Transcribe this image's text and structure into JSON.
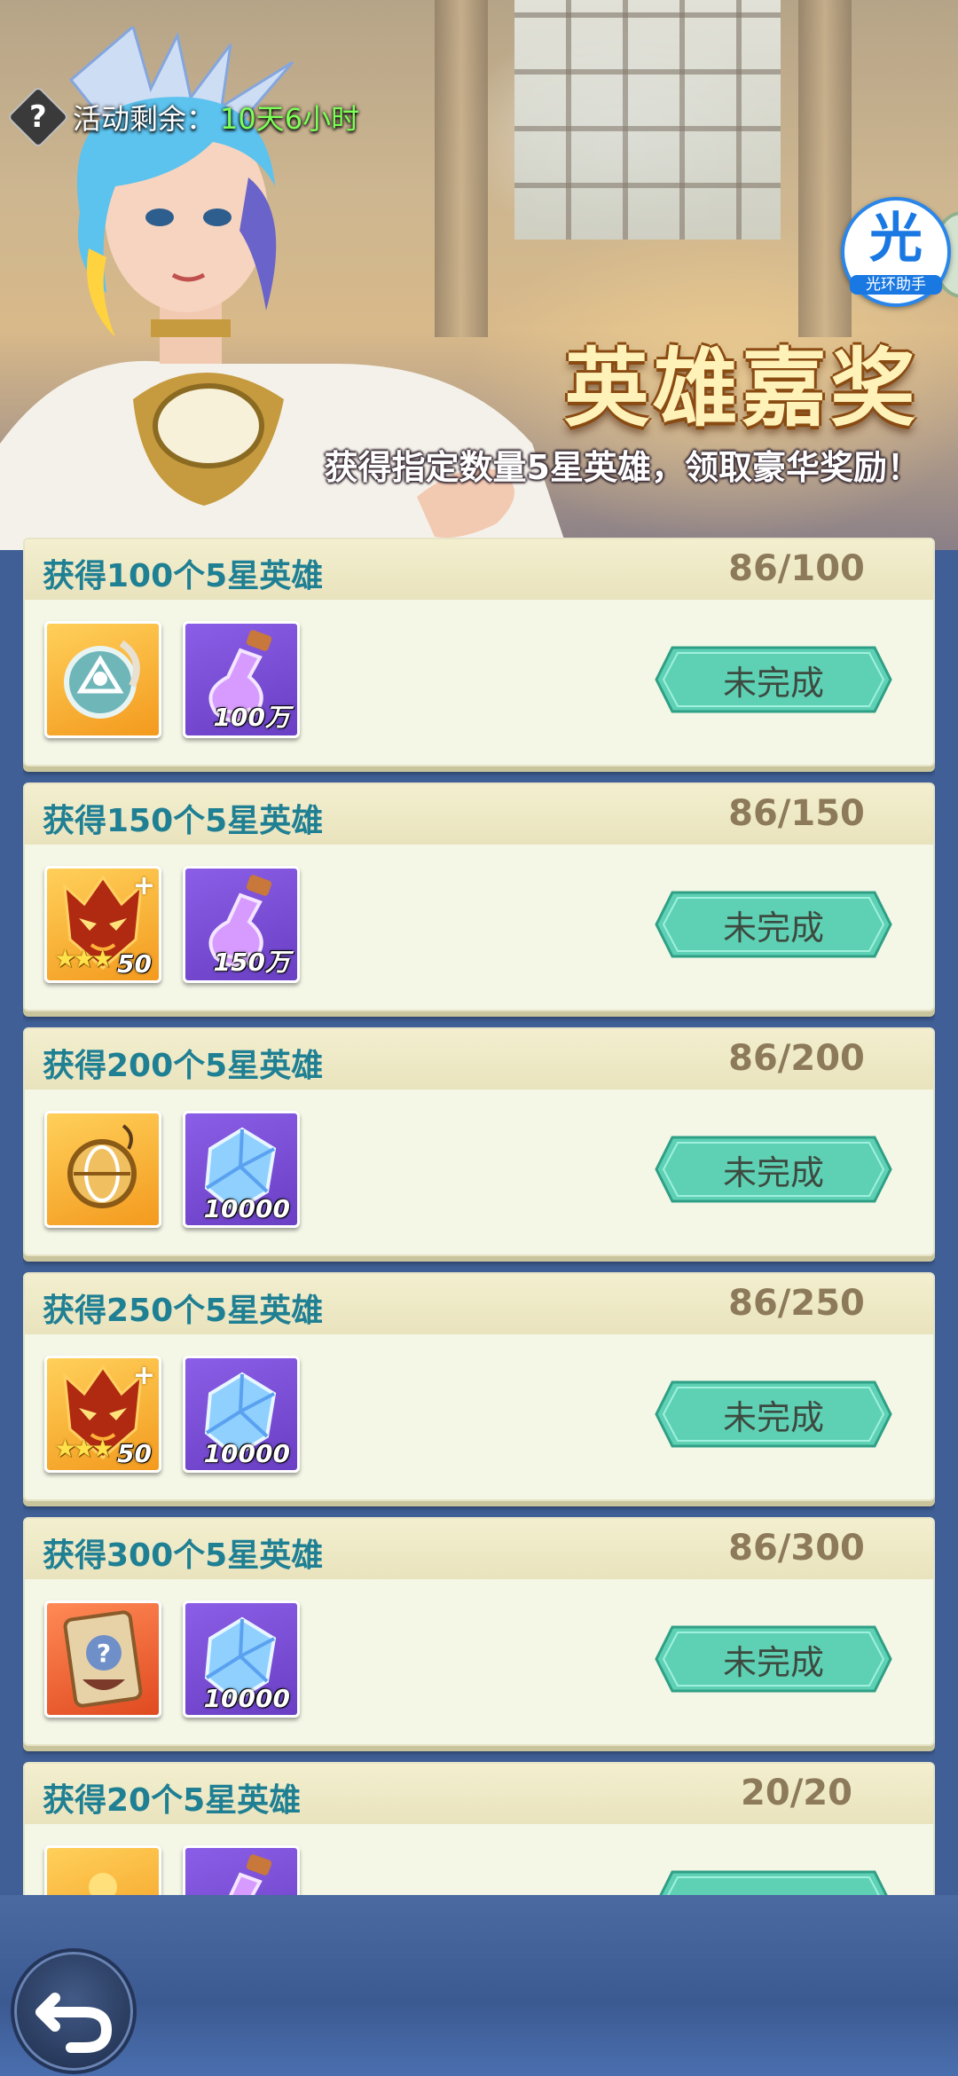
{
  "header": {
    "timer_label": "活动剩余：",
    "timer_value": "10天6小时",
    "title": "英雄嘉奖",
    "subtitle": "获得指定数量5星英雄，领取豪华奖励！",
    "assistant": {
      "glyph": "光",
      "label": "光环助手"
    }
  },
  "tasks": [
    {
      "title": "获得100个5星英雄",
      "progress": "86/100",
      "status": "未完成",
      "rewards": [
        {
          "icon": "rune-medallion-icon",
          "bg": "gold",
          "qty": ""
        },
        {
          "icon": "purple-potion-icon",
          "bg": "purple",
          "qty": "100万"
        }
      ]
    },
    {
      "title": "获得150个5星英雄",
      "progress": "86/150",
      "status": "未完成",
      "rewards": [
        {
          "icon": "fire-mask-icon",
          "bg": "gold",
          "qty": "50",
          "stars": "★★★"
        },
        {
          "icon": "purple-potion-icon",
          "bg": "purple",
          "qty": "150万"
        }
      ]
    },
    {
      "title": "获得200个5星英雄",
      "progress": "86/200",
      "status": "未完成",
      "rewards": [
        {
          "icon": "golden-pendant-icon",
          "bg": "gold",
          "qty": ""
        },
        {
          "icon": "blue-crystal-icon",
          "bg": "purple",
          "qty": "10000"
        }
      ]
    },
    {
      "title": "获得250个5星英雄",
      "progress": "86/250",
      "status": "未完成",
      "rewards": [
        {
          "icon": "fire-mask-icon",
          "bg": "gold",
          "qty": "50",
          "stars": "★★★"
        },
        {
          "icon": "blue-crystal-icon",
          "bg": "purple",
          "qty": "10000"
        }
      ]
    },
    {
      "title": "获得300个5星英雄",
      "progress": "86/300",
      "status": "未完成",
      "rewards": [
        {
          "icon": "mystery-card-icon",
          "bg": "card-red",
          "qty": ""
        },
        {
          "icon": "blue-crystal-icon",
          "bg": "purple",
          "qty": "10000"
        }
      ]
    },
    {
      "title": "获得20个5星英雄",
      "progress": "20/20",
      "status": "",
      "rewards": [
        {
          "icon": "gold-item-icon",
          "bg": "gold",
          "qty": ""
        },
        {
          "icon": "purple-potion-icon",
          "bg": "purple",
          "qty": ""
        }
      ]
    }
  ],
  "colors": {
    "task_title": "#1f7f93",
    "progress": "#8c7a5a",
    "button": "#5ed1b4",
    "timer_value": "#7cff56"
  }
}
